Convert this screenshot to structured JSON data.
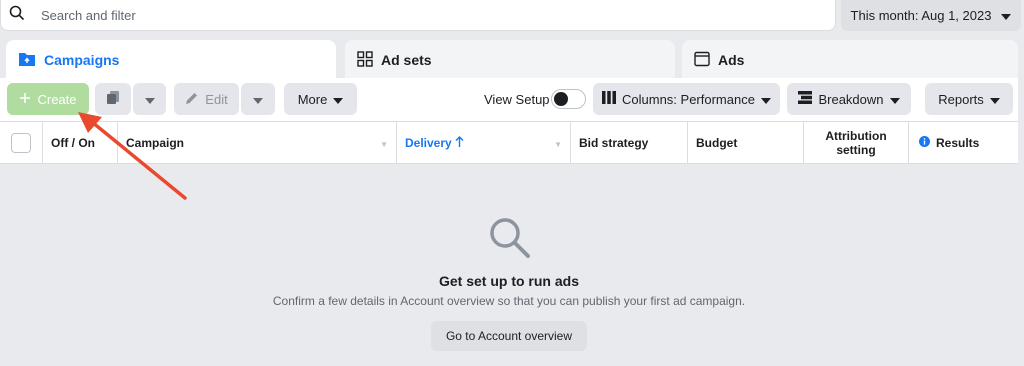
{
  "search": {
    "placeholder": "Search and filter"
  },
  "date_range": {
    "label": "This month: Aug 1, 2023"
  },
  "tabs": [
    {
      "label": "Campaigns",
      "icon": "folder-icon",
      "active": true
    },
    {
      "label": "Ad sets",
      "icon": "grid-icon",
      "active": false
    },
    {
      "label": "Ads",
      "icon": "window-icon",
      "active": false
    }
  ],
  "toolbar": {
    "create_label": "Create",
    "edit_label": "Edit",
    "more_label": "More",
    "view_setup_label": "View Setup",
    "view_setup_on": false,
    "columns_label": "Columns: Performance",
    "breakdown_label": "Breakdown",
    "reports_label": "Reports"
  },
  "table": {
    "columns": [
      "Off / On",
      "Campaign",
      "Delivery",
      "Bid strategy",
      "Budget",
      "Attribution setting",
      "Results"
    ],
    "sorted_column": "Delivery",
    "sort_direction": "ascending"
  },
  "empty_state": {
    "title": "Get set up to run ads",
    "description": "Confirm a few details in Account overview so that you can publish your first ad campaign.",
    "button_label": "Go to Account overview"
  },
  "colors": {
    "accent": "#1877f2",
    "annotation_arrow": "#e9492f",
    "create_button": "#b1dca0"
  }
}
